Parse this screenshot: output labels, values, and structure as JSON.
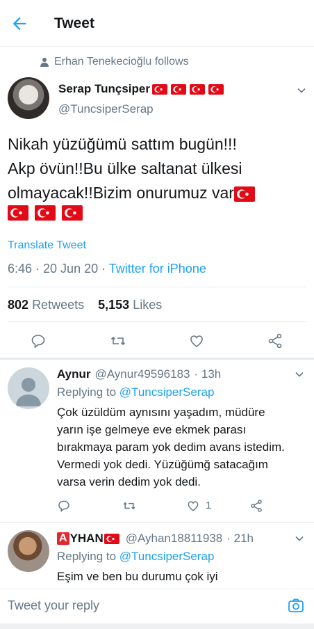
{
  "header": {
    "title": "Tweet"
  },
  "social_context": {
    "text": "Erhan Tenekecioğlu follows"
  },
  "tweet": {
    "author_name": "Serap Tunçsiper",
    "author_handle": "@TuncsiperSerap",
    "name_flags": 4,
    "text_line1": "Nikah yüzüğümü sattım bugün!!!",
    "text_line2": "Akp övün!!Bu ülke saltanat ülkesi",
    "text_line3": "olmayacak!!Bizim onurumuz var",
    "trailing_flags": 4,
    "translate_label": "Translate Tweet",
    "time": "6:46 · 20 Jun 20 · ",
    "client": "Twitter for iPhone",
    "retweets_count": "802",
    "retweets_label": "Retweets",
    "likes_count": "5,153",
    "likes_label": "Likes"
  },
  "icons": {
    "back": "arrow-left-icon",
    "chevron": "chevron-down-icon",
    "reply": "reply-icon",
    "retweet": "retweet-icon",
    "like": "heart-icon",
    "share": "share-icon",
    "camera": "camera-icon"
  },
  "replies": [
    {
      "name": "Aynur",
      "handle": "@Aynur49596183",
      "time": "· 13h",
      "replying_prefix": "Replying to ",
      "replying_to": "@TuncsiperSerap",
      "text": "Çok üzüldüm aynısını yaşadım, müdüre yarın işe gelmeye eve ekmek parası bırakmaya param yok dedim avans istedim. Vermedi yok dedi. Yüzüğümğ satacağım varsa verin dedim yok dedi.",
      "likes": "1"
    },
    {
      "name_badge": "A",
      "name": "YHAN",
      "handle": "@Ayhan18811938",
      "time": "· 21h",
      "replying_prefix": "Replying to ",
      "replying_to": "@TuncsiperSerap",
      "text": "Eşim ve ben bu durumu çok iyi"
    }
  ],
  "compose": {
    "placeholder": "Tweet your reply"
  },
  "colors": {
    "accent": "#1da1f2",
    "secondary_text": "#657786",
    "flag_red": "#e30a17"
  }
}
